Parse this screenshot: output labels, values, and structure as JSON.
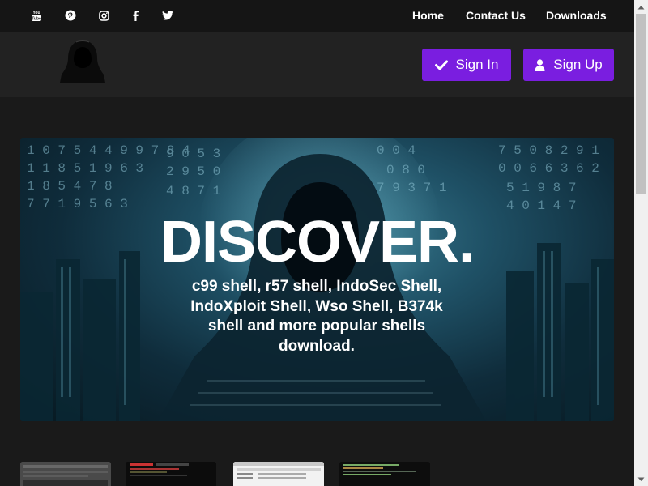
{
  "social_icons": [
    "youtube-icon",
    "pinterest-icon",
    "instagram-icon",
    "facebook-icon",
    "twitter-icon"
  ],
  "nav": {
    "home": "Home",
    "contact": "Contact Us",
    "downloads": "Downloads"
  },
  "header": {
    "logo_icon": "hooded-hacker-icon",
    "sign_in": "Sign In",
    "sign_up": "Sign Up",
    "sign_in_icon": "check-icon",
    "sign_up_icon": "user-icon"
  },
  "hero": {
    "title": "DISCOVER.",
    "subtitle": "c99 shell, r57 shell, IndoSec Shell, IndoXploit Shell, Wso Shell, B374k shell and more popular shells download."
  },
  "colors": {
    "topbar": "#151515",
    "header": "#222222",
    "page": "#1a1a1a",
    "accent": "#7a1ee0"
  }
}
